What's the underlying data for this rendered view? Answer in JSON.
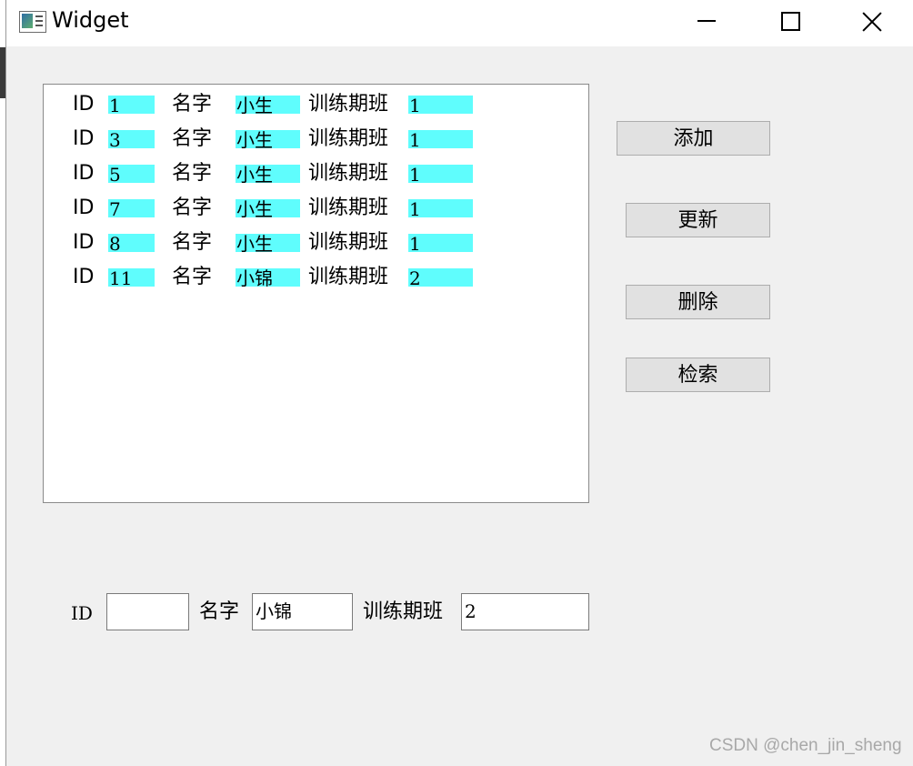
{
  "window": {
    "title": "Widget"
  },
  "list": {
    "field_labels": {
      "id": "ID",
      "name": "名字",
      "class": "训练期班"
    },
    "records": [
      {
        "id": "1",
        "name": "小生",
        "class": "1"
      },
      {
        "id": "3",
        "name": "小生",
        "class": "1"
      },
      {
        "id": "5",
        "name": "小生",
        "class": "1"
      },
      {
        "id": "7",
        "name": "小生",
        "class": "1"
      },
      {
        "id": "8",
        "name": "小生",
        "class": "1"
      },
      {
        "id": "11",
        "name": "小锦",
        "class": "2"
      }
    ]
  },
  "buttons": {
    "add": "添加",
    "update": "更新",
    "delete": "删除",
    "search": "检索"
  },
  "form": {
    "id_label": "ID",
    "id_value": "",
    "name_label": "名字",
    "name_value": "小锦",
    "class_label": "训练期班",
    "class_value": "2"
  },
  "watermark": "CSDN @chen_jin_sheng",
  "colors": {
    "highlight": "#5ffdfd",
    "button_bg": "#e1e1e1",
    "window_bg": "#f0f0f0"
  }
}
